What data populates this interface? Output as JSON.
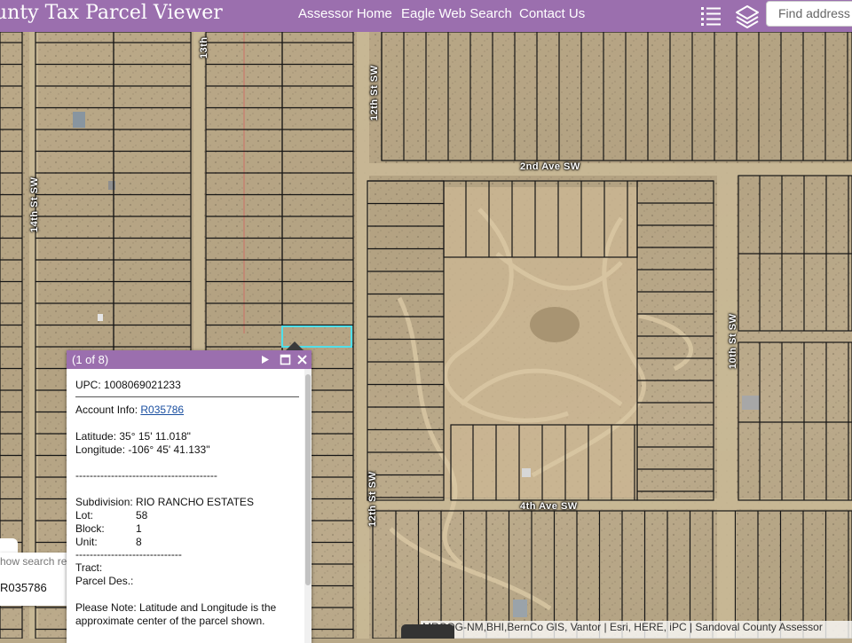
{
  "header": {
    "title": "unty Tax Parcel Viewer",
    "nav": [
      "Assessor Home",
      "Eagle Web Search",
      "Contact Us"
    ],
    "search_placeholder": "Find address",
    "list_icon": "list-icon",
    "layers_icon": "layers-icon"
  },
  "streets": {
    "thirteenth": "13th",
    "twelfth_north": "12th St SW",
    "second_ave": "2nd Ave SW",
    "fourteenth": "14th St SW",
    "tenth": "10th St SW",
    "twelfth_south": "12th St SW",
    "fourth_ave": "4th Ave SW"
  },
  "popup": {
    "count": "(1 of 8)",
    "upc": "UPC: 1008069021233",
    "account_label": "Account Info: ",
    "account_value": "R035786",
    "latitude": "Latitude: 35° 15' 11.018\"",
    "longitude": "Longitude: -106° 45' 41.133\"",
    "separator": "----------------------------------------",
    "subdivision": "Subdivision: RIO RANCHO ESTATES",
    "lot_label": "Lot:",
    "lot_value": "58",
    "block_label": "Block:",
    "block_value": "1",
    "unit_label": "Unit:",
    "unit_value": "8",
    "separator2": "------------------------------",
    "tract": "Tract:",
    "parcel_des": "Parcel Des.:",
    "note_line1": "Please Note: Latitude and Longitude is the",
    "note_line2": "approximate center of the parcel shown."
  },
  "side_widget": {
    "search_placeholder": "how search re",
    "value": "R035786"
  },
  "attribution": "MRCOG-NM,BHI,BernCo GIS, Vantor | Esri, HERE, iPC | Sandoval County Assessor",
  "colors": {
    "header": "#9b6fae",
    "selection": "#4fe0ea",
    "parcel_lines": "#1a1a1a",
    "link": "#1a4fa0"
  }
}
